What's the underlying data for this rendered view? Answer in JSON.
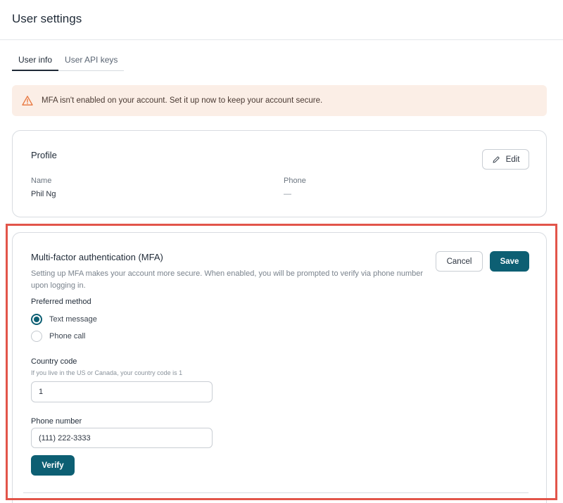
{
  "header": {
    "title": "User settings"
  },
  "tabs": [
    {
      "label": "User info",
      "active": true
    },
    {
      "label": "User API keys",
      "active": false
    }
  ],
  "alert": {
    "icon": "warning-triangle-icon",
    "text": "MFA isn't enabled on your account. Set it up now to keep your account secure.",
    "color": "#e8743b"
  },
  "profile": {
    "title": "Profile",
    "edit_label": "Edit",
    "fields": [
      {
        "label": "Name",
        "value": "Phil Ng"
      },
      {
        "label": "Phone",
        "value": "—"
      }
    ]
  },
  "mfa": {
    "title": "Multi-factor authentication (MFA)",
    "description": "Setting up MFA makes your account more secure. When enabled, you will be prompted to verify via phone number upon logging in.",
    "cancel_label": "Cancel",
    "save_label": "Save",
    "preferred_method_label": "Preferred method",
    "methods": [
      {
        "label": "Text message",
        "selected": true
      },
      {
        "label": "Phone call",
        "selected": false
      }
    ],
    "country_code": {
      "label": "Country code",
      "hint": "If you live in the US or Canada, your country code is 1",
      "value": "1"
    },
    "phone_number": {
      "label": "Phone number",
      "value": "(111) 222-3333"
    },
    "verify_label": "Verify"
  },
  "colors": {
    "accent": "#0d5f73",
    "highlight": "#e2554a",
    "alert_bg": "#fbeee6"
  }
}
